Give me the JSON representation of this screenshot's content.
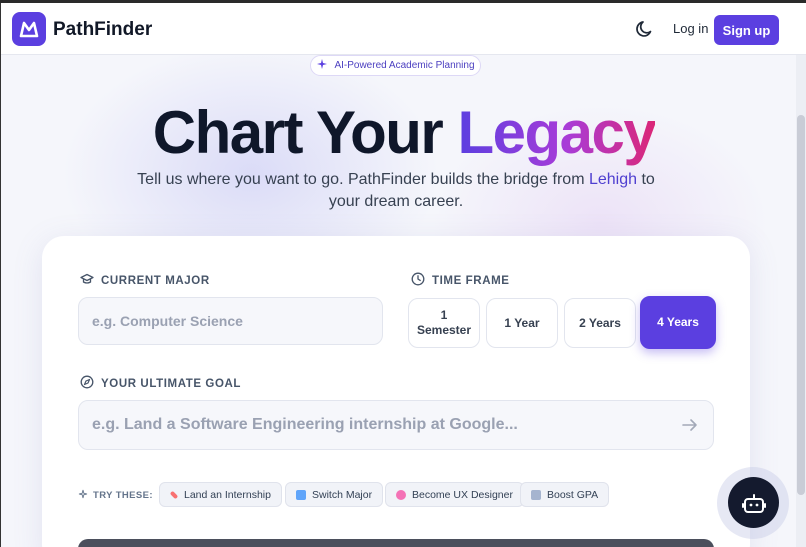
{
  "header": {
    "brand": "PathFinder",
    "login_label": "Log in",
    "signup_label": "Sign up"
  },
  "hero": {
    "badge": "AI-Powered Academic Planning",
    "title_plain": "Chart Your ",
    "title_accent": "Legacy",
    "subtitle_before": "Tell us where you want to go. PathFinder builds the bridge from ",
    "subtitle_highlight": "Lehigh",
    "subtitle_after": " to your dream career."
  },
  "form": {
    "major_label": "CURRENT MAJOR",
    "major_placeholder": "e.g. Computer Science",
    "timeframe_label": "TIME FRAME",
    "timeframes": [
      {
        "line1": "1",
        "line2": "Semester"
      },
      {
        "label": "1 Year"
      },
      {
        "label": "2 Years"
      },
      {
        "label": "4 Years"
      }
    ],
    "selected_timeframe": "4 Years",
    "goal_label": "YOUR ULTIMATE GOAL",
    "goal_placeholder": "e.g. Land a Software Engineering internship at Google...",
    "try_label": "TRY THESE:",
    "suggestions": [
      "Land an Internship",
      "Switch Major",
      "Become UX Designer",
      "Boost GPA"
    ]
  },
  "colors": {
    "accent": "#5b3fe0",
    "accent_pink": "#db2777",
    "dark": "#0f172a"
  },
  "icons": [
    "mountain-logo-icon",
    "moon-icon",
    "sparkle-icon",
    "graduation-cap-icon",
    "clock-icon",
    "compass-icon",
    "arrow-right-icon",
    "robot-icon"
  ]
}
